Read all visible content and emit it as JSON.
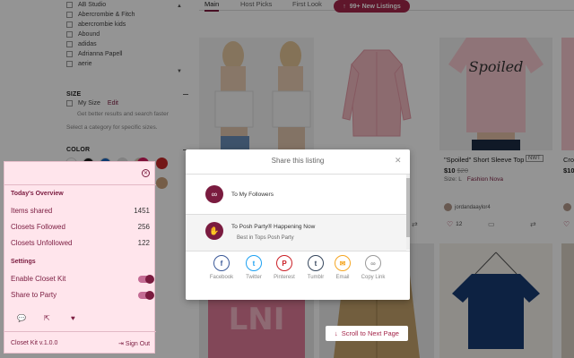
{
  "sidebar": {
    "brands": [
      "AB Studio",
      "Abercrombie & Fitch",
      "abercrombie kids",
      "Abound",
      "adidas",
      "Adrianna Papell",
      "aerie"
    ],
    "size_heading": "SIZE",
    "my_size_label": "My Size",
    "edit_label": "Edit",
    "size_hint": "Get better results and search faster",
    "size_hint2": "Select a category for specific sizes.",
    "color_heading": "COLOR",
    "swatch_colors": [
      "#ffffff",
      "#1a1a1a",
      "#1565c0",
      "#e0e0e0",
      "#e0c9a6",
      "#ffffff",
      "#d81b60",
      "#c62828",
      "#caa07a"
    ]
  },
  "tabs": [
    {
      "label": "Main"
    },
    {
      "label": "Host Picks"
    },
    {
      "label": "First Look"
    }
  ],
  "new_listings_button": "99+ New Listings",
  "listing": {
    "title": "\"Spoiled\" Short Sleeve Top",
    "price": "$10",
    "original_price": "$20",
    "badge": "NWT",
    "size": "Size: L",
    "brand": "Fashion Nova",
    "user": "jordandaaylor4",
    "likes": "12",
    "partial_title": "Cro",
    "partial_price": "$10"
  },
  "panel": {
    "overview_heading": "Today's Overview",
    "stats": [
      {
        "label": "Items shared",
        "value": "1451"
      },
      {
        "label": "Closets Followed",
        "value": "256"
      },
      {
        "label": "Closets Unfollowed",
        "value": "122"
      }
    ],
    "settings_heading": "Settings",
    "toggles": [
      {
        "label": "Enable Closet Kit",
        "on": true
      },
      {
        "label": "Share to Party",
        "on": true
      }
    ],
    "version": "Closet Kit v.1.0.0",
    "sign_out": "Sign Out",
    "icons": [
      "chat-icon",
      "external-link-icon",
      "heart-icon",
      "close-icon",
      "sign-out-icon"
    ]
  },
  "modal": {
    "title": "Share this listing",
    "options": [
      {
        "label": "To My Followers",
        "icon": "share-chain-icon"
      },
      {
        "label": "To Posh Party® Happening Now",
        "sub": "Best in Tops Posh Party",
        "icon": "party-hand-icon"
      }
    ],
    "socials": [
      {
        "label": "Facebook",
        "glyph": "f",
        "color": "#3b5998"
      },
      {
        "label": "Twitter",
        "glyph": "t",
        "color": "#1da1f2"
      },
      {
        "label": "Pinterest",
        "glyph": "P",
        "color": "#cb2027"
      },
      {
        "label": "Tumblr",
        "glyph": "t",
        "color": "#35465c"
      },
      {
        "label": "Email",
        "glyph": "✉",
        "color": "#f5a623"
      },
      {
        "label": "Copy Link",
        "glyph": "∞",
        "color": "#999999"
      }
    ]
  },
  "scroll_next": "Scroll to Next Page",
  "colors": {
    "accent": "#7a1b3f",
    "accent_light": "#a4264a",
    "panel_bg": "#ffe5ec"
  }
}
